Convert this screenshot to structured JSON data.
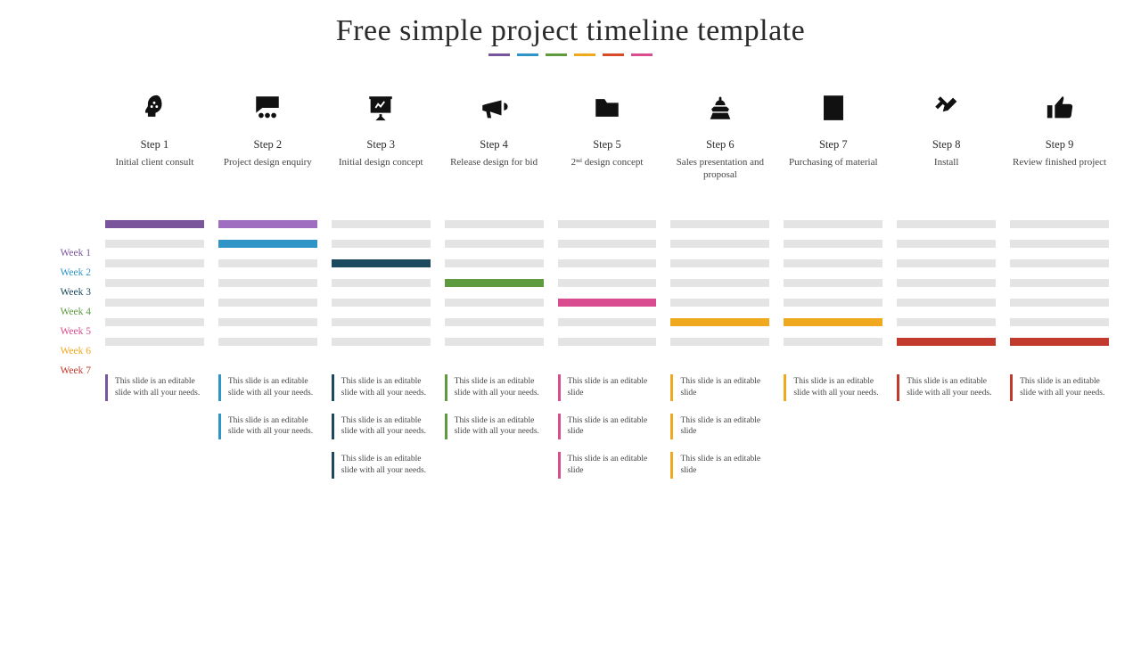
{
  "title": "Free simple project timeline template",
  "divider_colors": [
    "#7b559c",
    "#2f95c7",
    "#5e9b3e",
    "#f0a81e",
    "#d84a2a",
    "#d94c8f"
  ],
  "weeks": [
    {
      "label": "Week 1",
      "color": "#7b559c"
    },
    {
      "label": "Week 2",
      "color": "#2f95c7"
    },
    {
      "label": "Week 3",
      "color": "#1b4a5e"
    },
    {
      "label": "Week 4",
      "color": "#5e9b3e"
    },
    {
      "label": "Week 5",
      "color": "#d94c8f"
    },
    {
      "label": "Week 6",
      "color": "#f0a81e"
    },
    {
      "label": "Week 7",
      "color": "#c23a2d"
    }
  ],
  "steps": [
    {
      "title": "Step 1",
      "desc": "Initial client consult",
      "icon": "head-gears",
      "color": "#7b559c",
      "gantt_highlight_rows": [
        0
      ],
      "notes": [
        "This slide is an editable slide with all your needs."
      ]
    },
    {
      "title": "Step 2",
      "desc": "Project design enquiry",
      "icon": "discussion",
      "color": "#2f95c7",
      "gantt_highlight_rows": [
        0,
        1
      ],
      "gantt_row_colors": {
        "0": "#a06ec0",
        "1": "#2f95c7"
      },
      "notes": [
        "This slide is an editable slide with all your needs.",
        "This slide is an editable slide with all your needs."
      ]
    },
    {
      "title": "Step 3",
      "desc": "Initial design concept",
      "icon": "presentation",
      "color": "#1b4a5e",
      "gantt_highlight_rows": [
        2
      ],
      "notes": [
        "This slide is an editable slide with all your needs.",
        "This slide is an editable slide with all your needs.",
        "This slide is an editable slide with all your needs."
      ]
    },
    {
      "title": "Step 4",
      "desc": "Release design for bid",
      "icon": "megaphone",
      "color": "#5e9b3e",
      "gantt_highlight_rows": [
        3
      ],
      "notes": [
        "This slide is an editable slide with all your needs.",
        "This slide is an editable slide with all your needs."
      ]
    },
    {
      "title": "Step 5",
      "desc": "2ⁿᵈ design concept",
      "icon": "folder",
      "color": "#d94c8f",
      "gantt_highlight_rows": [
        4
      ],
      "notes": [
        "This slide is an editable slide",
        "This slide is an editable slide",
        "This slide is an editable slide"
      ]
    },
    {
      "title": "Step 6",
      "desc": "Sales presentation and proposal",
      "icon": "engineer",
      "color": "#f0a81e",
      "gantt_highlight_rows": [
        5
      ],
      "notes": [
        "This slide is an editable slide",
        "This slide is an editable slide",
        "This slide is an editable slide"
      ]
    },
    {
      "title": "Step 7",
      "desc": "Purchasing of material",
      "icon": "checklist",
      "color": "#f0a81e",
      "gantt_highlight_rows": [
        5
      ],
      "notes": [
        "This slide is an editable slide with all your needs."
      ]
    },
    {
      "title": "Step 8",
      "desc": "Install",
      "icon": "tools",
      "color": "#c23a2d",
      "gantt_highlight_rows": [
        6
      ],
      "notes": [
        "This slide is an editable slide with all your needs."
      ]
    },
    {
      "title": "Step 9",
      "desc": "Review finished project",
      "icon": "thumbs-up",
      "color": "#c23a2d",
      "gantt_highlight_rows": [
        6
      ],
      "notes": [
        "This slide is an editable slide with all your needs."
      ]
    }
  ],
  "chart_data": {
    "type": "table",
    "title": "Project timeline Gantt (step × week, 1 = active)",
    "row_labels": [
      "Week 1",
      "Week 2",
      "Week 3",
      "Week 4",
      "Week 5",
      "Week 6",
      "Week 7"
    ],
    "col_labels": [
      "Step 1",
      "Step 2",
      "Step 3",
      "Step 4",
      "Step 5",
      "Step 6",
      "Step 7",
      "Step 8",
      "Step 9"
    ],
    "matrix": [
      [
        1,
        1,
        0,
        0,
        0,
        0,
        0,
        0,
        0
      ],
      [
        0,
        1,
        0,
        0,
        0,
        0,
        0,
        0,
        0
      ],
      [
        0,
        0,
        1,
        0,
        0,
        0,
        0,
        0,
        0
      ],
      [
        0,
        0,
        0,
        1,
        0,
        0,
        0,
        0,
        0
      ],
      [
        0,
        0,
        0,
        0,
        1,
        0,
        0,
        0,
        0
      ],
      [
        0,
        0,
        0,
        0,
        0,
        1,
        1,
        0,
        0
      ],
      [
        0,
        0,
        0,
        0,
        0,
        0,
        0,
        1,
        1
      ]
    ]
  }
}
